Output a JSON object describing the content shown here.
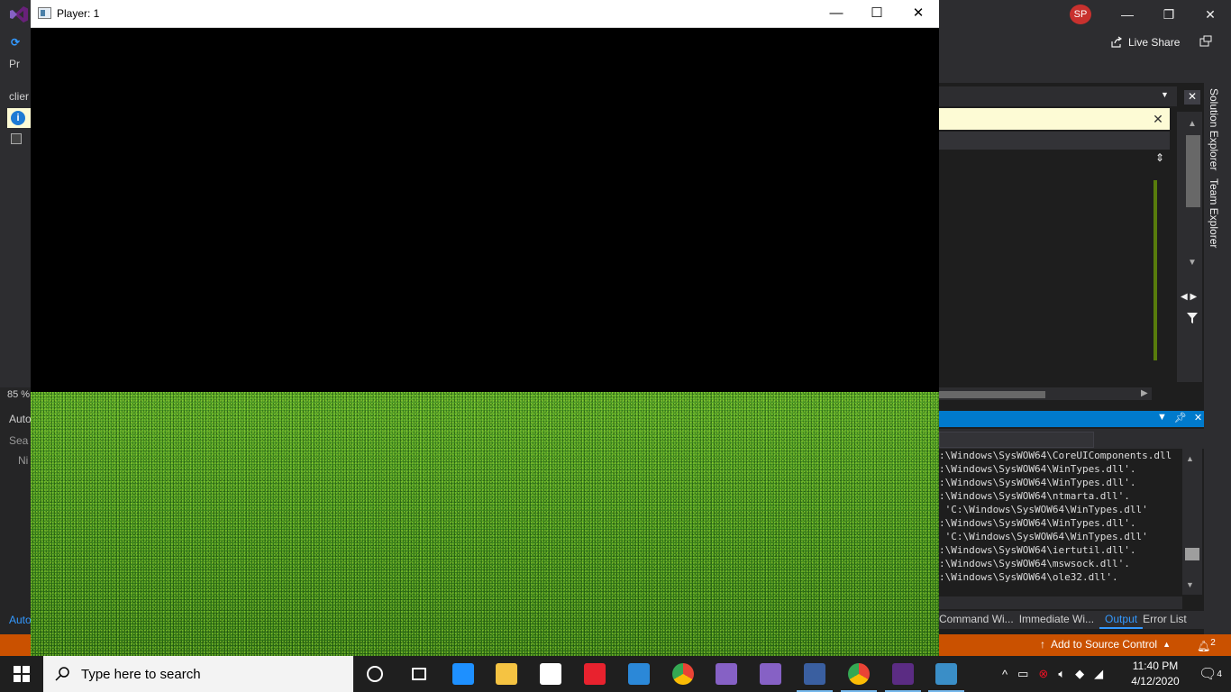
{
  "player": {
    "title": "Player: 1",
    "minimize": "—",
    "maximize": "☐",
    "close": "✕"
  },
  "vs": {
    "avatar_initials": "SP",
    "minimize": "—",
    "restore": "❐",
    "close": "✕",
    "live_share": "Live Share",
    "left_fragments": {
      "pr": "Pr",
      "client": "clier",
      "zoom": "85 %",
      "auto": "Auto",
      "search": "Sea",
      "name": "Ni",
      "auto_tab": "Auto"
    },
    "info_icon": "i",
    "info_close": "✕",
    "output_lines": [
      ":\\Windows\\SysWOW64\\CoreUIComponents.dll",
      ":\\Windows\\SysWOW64\\WinTypes.dll'.",
      ":\\Windows\\SysWOW64\\WinTypes.dll'.",
      ":\\Windows\\SysWOW64\\ntmarta.dll'.",
      " 'C:\\Windows\\SysWOW64\\WinTypes.dll'",
      ":\\Windows\\SysWOW64\\WinTypes.dll'.",
      " 'C:\\Windows\\SysWOW64\\WinTypes.dll'",
      ":\\Windows\\SysWOW64\\iertutil.dll'.",
      ":\\Windows\\SysWOW64\\mswsock.dll'.",
      ":\\Windows\\SysWOW64\\ole32.dll'."
    ],
    "tool_tabs": [
      "Command Wi...",
      "Immediate Wi...",
      "Output",
      "Error List"
    ],
    "active_tool_tab": "Output",
    "right_tabs": [
      "Solution Explorer",
      "Team Explorer"
    ],
    "status": {
      "add_source_control": "Add to Source Control",
      "notifications": "2"
    }
  },
  "taskbar": {
    "search_placeholder": "Type here to search",
    "apps": [
      {
        "name": "cortana-icon",
        "color": "#ffffff"
      },
      {
        "name": "task-view-icon",
        "color": "#ffffff"
      },
      {
        "name": "edge-icon",
        "color": "#1e90ff"
      },
      {
        "name": "file-explorer-icon",
        "color": "#f5c342"
      },
      {
        "name": "store-icon",
        "color": "#ffffff"
      },
      {
        "name": "gift-icon",
        "color": "#e8222e"
      },
      {
        "name": "mail-icon",
        "color": "#2b88d8"
      },
      {
        "name": "chrome-icon",
        "color": "#34a853"
      },
      {
        "name": "visual-studio-icon",
        "color": "#8661c5"
      },
      {
        "name": "visual-studio-2-icon",
        "color": "#8661c5"
      },
      {
        "name": "app-window-icon",
        "color": "#3a5fa0"
      },
      {
        "name": "chrome-profile-icon",
        "color": "#34a853"
      },
      {
        "name": "terminal-icon",
        "color": "#5b2c83"
      },
      {
        "name": "player-app-icon",
        "color": "#3a8ec7"
      }
    ],
    "time": "11:40 PM",
    "date": "4/12/2020",
    "action_center_badge": "4"
  }
}
